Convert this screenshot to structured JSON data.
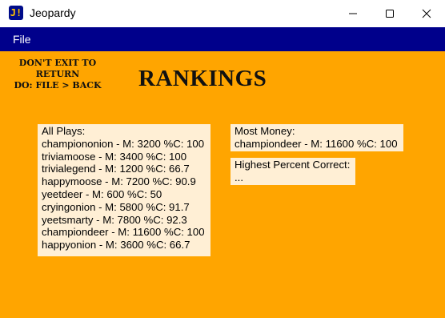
{
  "window": {
    "title": "Jeopardy",
    "icon_glyph": "J!",
    "controls": [
      "minimize-icon",
      "maximize-icon",
      "close-icon"
    ]
  },
  "menu": {
    "file_label": "File"
  },
  "notice": {
    "text": "DON'T EXIT TO\nRETURN\nDO: FILE > BACK"
  },
  "heading": "RANKINGS",
  "all_plays": {
    "header": "All Plays:",
    "entries": [
      "championonion - M: 3200 %C: 100",
      "triviamoose - M: 3400 %C: 100",
      "trivialegend - M: 1200 %C: 66.7",
      "happymoose - M: 7200 %C: 90.9",
      "yeetdeer - M: 600 %C: 50",
      "cryingonion - M: 5800 %C: 91.7",
      "yeetsmarty - M: 7800 %C: 92.3",
      "championdeer - M: 11600 %C: 100",
      "happyonion - M: 3600 %C: 66.7"
    ]
  },
  "most_money": {
    "header": "Most Money:",
    "value": "championdeer - M: 11600 %C: 100"
  },
  "highest_percent": {
    "header": "Highest Percent Correct:",
    "value": "..."
  },
  "colors": {
    "background": "#FFA500",
    "menubar": "#00008B",
    "panel": "#FFEFD5"
  }
}
